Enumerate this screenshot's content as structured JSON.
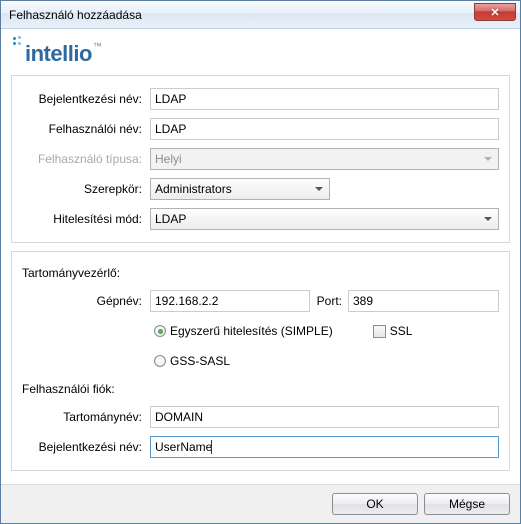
{
  "window": {
    "title": "Felhasználó hozzáadása"
  },
  "logo": {
    "text": "intellio"
  },
  "fields": {
    "login_name_label": "Bejelentkezési név:",
    "login_name_value": "LDAP",
    "user_name_label": "Felhasználói név:",
    "user_name_value": "LDAP",
    "user_type_label": "Felhasználó típusa:",
    "user_type_value": "Helyi",
    "role_label": "Szerepkör:",
    "role_value": "Administrators",
    "auth_mode_label": "Hitelesítési mód:",
    "auth_mode_value": "LDAP"
  },
  "domain_controller": {
    "section_title": "Tartományvezérlő:",
    "hostname_label": "Gépnév:",
    "hostname_value": "192.168.2.2",
    "port_label": "Port:",
    "port_value": "389",
    "simple_auth_label": "Egyszerű hitelesítés (SIMPLE)",
    "ssl_label": "SSL",
    "gss_label": "GSS-SASL"
  },
  "user_account": {
    "section_title": "Felhasználói fiók:",
    "domain_label": "Tartománynév:",
    "domain_value": "DOMAIN",
    "login_label": "Bejelentkezési név:",
    "login_value": "UserName"
  },
  "buttons": {
    "ok": "OK",
    "cancel": "Mégse"
  }
}
